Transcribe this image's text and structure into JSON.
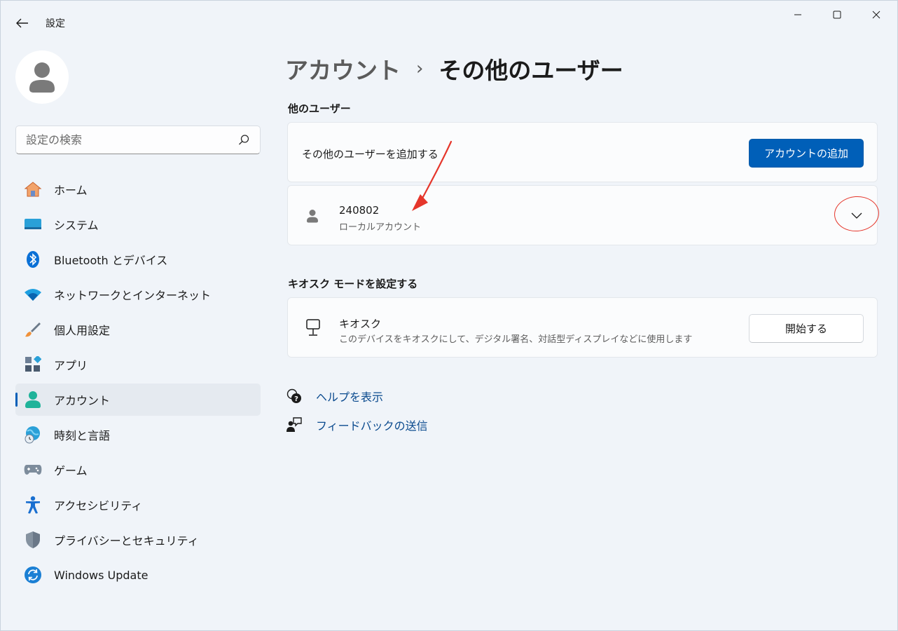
{
  "window": {
    "app_title": "設定"
  },
  "sidebar": {
    "search": {
      "placeholder": "設定の検索",
      "value": ""
    },
    "items": [
      {
        "label": "ホーム",
        "icon": "home-icon"
      },
      {
        "label": "システム",
        "icon": "system-icon"
      },
      {
        "label": "Bluetooth とデバイス",
        "icon": "bluetooth-icon"
      },
      {
        "label": "ネットワークとインターネット",
        "icon": "wifi-icon"
      },
      {
        "label": "個人用設定",
        "icon": "brush-icon"
      },
      {
        "label": "アプリ",
        "icon": "apps-icon"
      },
      {
        "label": "アカウント",
        "icon": "account-icon",
        "active": true
      },
      {
        "label": "時刻と言語",
        "icon": "globe-clock-icon"
      },
      {
        "label": "ゲーム",
        "icon": "gamepad-icon"
      },
      {
        "label": "アクセシビリティ",
        "icon": "accessibility-icon"
      },
      {
        "label": "プライバシーとセキュリティ",
        "icon": "shield-icon"
      },
      {
        "label": "Windows Update",
        "icon": "windows-update-icon"
      }
    ]
  },
  "main": {
    "breadcrumb": {
      "parent": "アカウント",
      "separator": "›",
      "current": "その他のユーザー"
    },
    "other_users": {
      "section_title": "他のユーザー",
      "add_user_text": "その他のユーザーを追加する",
      "add_account_button": "アカウントの追加",
      "user": {
        "name": "240802",
        "type": "ローカルアカウント"
      }
    },
    "kiosk": {
      "section_title": "キオスク モードを設定する",
      "title": "キオスク",
      "description": "このデバイスをキオスクにして、デジタル署名、対話型ディスプレイなどに使用します",
      "start_button": "開始する"
    },
    "links": {
      "help": "ヘルプを表示",
      "feedback": "フィードバックの送信"
    }
  },
  "colors": {
    "accent": "#005fb8",
    "annotation": "#e5362b",
    "link": "#0a4a8e"
  }
}
